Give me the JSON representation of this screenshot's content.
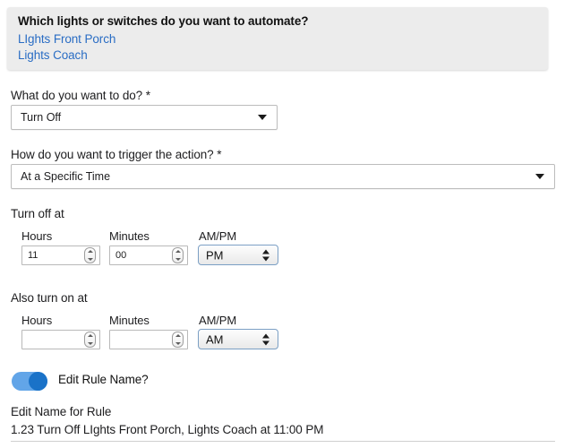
{
  "panel": {
    "question": "Which lights or switches do you want to automate?",
    "devices": [
      "LIghts Front Porch",
      "Lights Coach"
    ]
  },
  "action_field": {
    "label": "What do you want to do? *",
    "value": "Turn Off"
  },
  "trigger_field": {
    "label": "How do you want to trigger the action? *",
    "value": "At a Specific Time"
  },
  "turn_off_at": {
    "section_label": "Turn off at",
    "hours_label": "Hours",
    "minutes_label": "Minutes",
    "ampm_label": "AM/PM",
    "hours_value": "11",
    "minutes_value": "00",
    "ampm_value": "PM"
  },
  "turn_on_at": {
    "section_label": "Also turn on at",
    "hours_label": "Hours",
    "minutes_label": "Minutes",
    "ampm_label": "AM/PM",
    "hours_value": "",
    "minutes_value": "",
    "ampm_value": "AM"
  },
  "edit_rule": {
    "toggle_label": "Edit Rule Name?",
    "name_label": "Edit Name for Rule",
    "name_value": "1.23 Turn Off LIghts Front Porch, Lights Coach at 11:00 PM"
  },
  "colors": {
    "link": "#2a6dc4",
    "panel_bg": "#ececec",
    "toggle_track": "#62a5e8",
    "toggle_knob": "#1a72c8"
  }
}
